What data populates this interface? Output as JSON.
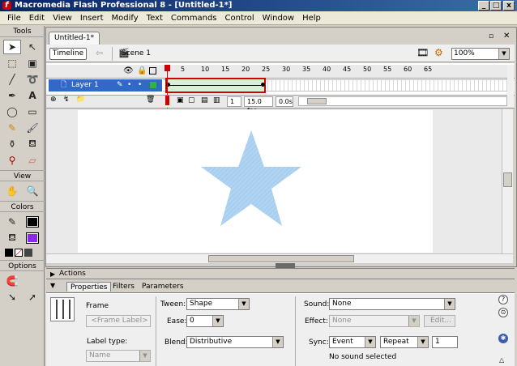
{
  "window": {
    "title": "Macromedia Flash Professional 8 - [Untitled-1*]",
    "min_label": "_",
    "max_label": "□",
    "close_label": "x"
  },
  "menu": [
    "File",
    "Edit",
    "View",
    "Insert",
    "Modify",
    "Text",
    "Commands",
    "Control",
    "Window",
    "Help"
  ],
  "tools": {
    "header": "Tools",
    "view_header": "View",
    "colors_header": "Colors",
    "options_header": "Options"
  },
  "document": {
    "tab": "Untitled-1*",
    "timeline_button": "Timeline",
    "scene": "Scene 1",
    "zoom": "100%"
  },
  "timeline": {
    "layer_name": "Layer 1",
    "ruler_ticks": [
      "1",
      "5",
      "10",
      "15",
      "20",
      "25",
      "30",
      "35",
      "40",
      "45",
      "50",
      "55",
      "60",
      "65"
    ],
    "current_frame": "1",
    "fps": "15.0 fps",
    "time": "0.0s"
  },
  "stage": {
    "shape_color": "#a9cff0"
  },
  "panels": {
    "actions": "Actions",
    "tabs": [
      "Properties",
      "Filters",
      "Parameters"
    ]
  },
  "properties": {
    "frame_label": "Frame",
    "frame_label_placeholder": "<Frame Label>",
    "label_type_label": "Label type:",
    "label_type_value": "Name",
    "tween_label": "Tween:",
    "tween_value": "Shape",
    "ease_label": "Ease:",
    "ease_value": "0",
    "blend_label": "Blend:",
    "blend_value": "Distributive",
    "sound_label": "Sound:",
    "sound_value": "None",
    "effect_label": "Effect:",
    "effect_value": "None",
    "edit_button": "Edit...",
    "sync_label": "Sync:",
    "sync_value": "Event",
    "repeat_value": "Repeat",
    "repeat_count": "1",
    "sound_status": "No sound selected"
  }
}
